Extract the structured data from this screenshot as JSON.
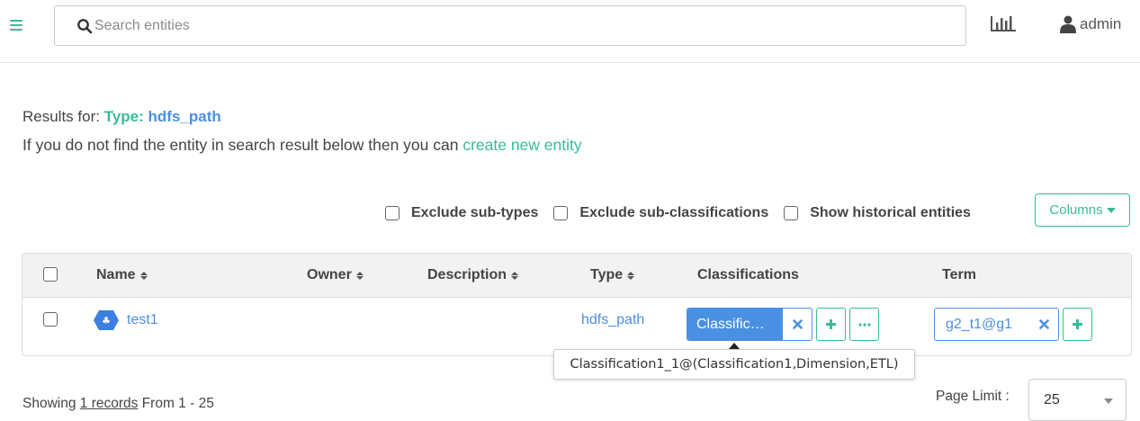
{
  "header": {
    "search_placeholder": "Search entities",
    "user_name": "admin"
  },
  "results": {
    "prefix": "Results for:",
    "type_label": "Type:",
    "type_value": "hdfs_path",
    "info_text": "If you do not find the entity in search result below then you can",
    "create_link": "create new entity"
  },
  "filters": [
    {
      "label": "Exclude sub-types",
      "checked": false
    },
    {
      "label": "Exclude sub-classifications",
      "checked": false
    },
    {
      "label": "Show historical entities",
      "checked": false
    }
  ],
  "columns_button": "Columns",
  "table": {
    "headers": {
      "name": "Name",
      "owner": "Owner",
      "description": "Description",
      "type": "Type",
      "classifications": "Classifications",
      "term": "Term"
    },
    "rows": [
      {
        "name": "test1",
        "owner": "",
        "description": "",
        "type": "hdfs_path",
        "classification_tag": "Classific…",
        "term": "g2_t1@g1"
      }
    ]
  },
  "tooltip": "Classification1_1@(Classification1,Dimension,ETL)",
  "footer": {
    "showing_prefix": "Showing",
    "records_link": "1 records",
    "showing_suffix": "From 1 - 25",
    "page_limit_label": "Page Limit :",
    "page_limit_value": "25"
  },
  "colors": {
    "accent_green": "#37bb9b",
    "link_blue": "#4a90e2",
    "text_dark": "#444444"
  },
  "icons": [
    "menu-icon",
    "search-icon",
    "statistics-icon",
    "user-icon",
    "entity-type-icon",
    "remove-icon",
    "add-icon",
    "more-icon",
    "dropdown-caret-icon"
  ]
}
